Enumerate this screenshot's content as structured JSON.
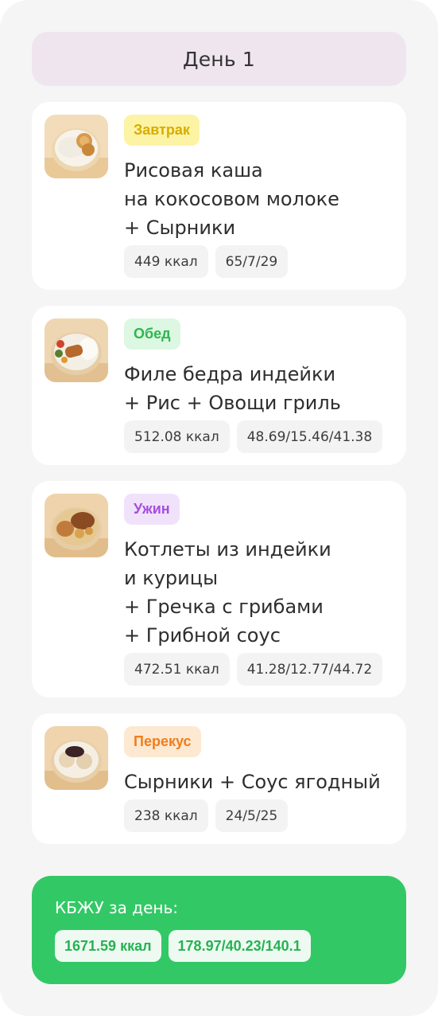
{
  "day": {
    "title": "День 1"
  },
  "meals": [
    {
      "tag": "Завтрак",
      "title": "Рисовая каша\nна кокосовом молоке\n+ Сырники",
      "kcal": "449 ккал",
      "macros": "65/7/29",
      "image_icon": "rice-porridge-syrniki-bowl"
    },
    {
      "tag": "Обед",
      "title": "Филе бедра индейки\n+ Рис + Овощи гриль",
      "kcal": "512.08 ккал",
      "macros": "48.69/15.46/41.38",
      "image_icon": "turkey-rice-grilled-vegetables-bowl"
    },
    {
      "tag": "Ужин",
      "title": "Котлеты из индейки\nи курицы\n+ Гречка с грибами\n+ Грибной соус",
      "kcal": "472.51 ккал",
      "macros": "41.28/12.77/44.72",
      "image_icon": "cutlets-buckwheat-bowl"
    },
    {
      "tag": "Перекус",
      "title": "Сырники + Соус ягодный",
      "kcal": "238 ккал",
      "macros": "24/5/25",
      "image_icon": "syrniki-berry-sauce-bowl"
    }
  ],
  "summary": {
    "title": "КБЖУ за день:",
    "kcal": "1671.59 ккал",
    "macros": "178.97/40.23/140.1"
  },
  "colors": {
    "header_bg": "#efe5ef",
    "breakfast_tag": "#d6ad00",
    "lunch_tag": "#31b550",
    "dinner_tag": "#a54dde",
    "snack_tag": "#ef7d1d",
    "summary_bg": "#33c866"
  }
}
